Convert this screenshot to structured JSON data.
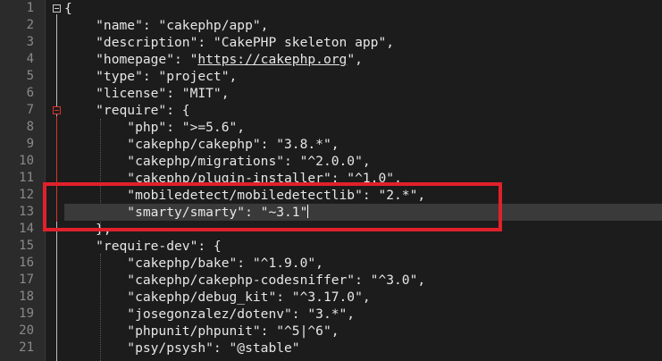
{
  "editor": {
    "lines": [
      {
        "num": "1",
        "text": "{"
      },
      {
        "num": "2",
        "text": "    \"name\": \"cakephp/app\","
      },
      {
        "num": "3",
        "text": "    \"description\": \"CakePHP skeleton app\","
      },
      {
        "num": "4",
        "pre": "    \"homepage\": \"",
        "link": "https://cakephp.org",
        "post": "\","
      },
      {
        "num": "5",
        "text": "    \"type\": \"project\","
      },
      {
        "num": "6",
        "text": "    \"license\": \"MIT\","
      },
      {
        "num": "7",
        "text": "    \"require\": {"
      },
      {
        "num": "8",
        "text": "        \"php\": \">=5.6\","
      },
      {
        "num": "9",
        "text": "        \"cakephp/cakephp\": \"3.8.*\","
      },
      {
        "num": "10",
        "text": "        \"cakephp/migrations\": \"^2.0.0\","
      },
      {
        "num": "11",
        "text": "        \"cakephp/plugin-installer\": \"^1.0\","
      },
      {
        "num": "12",
        "text": "        \"mobiledetect/mobiledetectlib\": \"2.*\","
      },
      {
        "num": "13",
        "text": "        \"smarty/smarty\": \"~3.1\""
      },
      {
        "num": "14",
        "text": "    },"
      },
      {
        "num": "15",
        "text": "    \"require-dev\": {"
      },
      {
        "num": "16",
        "text": "        \"cakephp/bake\": \"^1.9.0\","
      },
      {
        "num": "17",
        "text": "        \"cakephp/cakephp-codesniffer\": \"^3.0\","
      },
      {
        "num": "18",
        "text": "        \"cakephp/debug_kit\": \"^3.17.0\","
      },
      {
        "num": "19",
        "text": "        \"josegonzalez/dotenv\": \"3.*\","
      },
      {
        "num": "20",
        "text": "        \"phpunit/phpunit\": \"^5|^6\","
      },
      {
        "num": "21",
        "text": "        \"psy/psysh\": \"@stable\""
      }
    ],
    "current_line": "13",
    "colors": {
      "background": "#1c1c1c",
      "gutter": "#2b2b2b",
      "current_line": "#3a3a3a",
      "fold_marker": "#d9342b",
      "highlight_box": "#e0212b",
      "text": "#e6e6e6",
      "line_number": "#8a8a8a"
    }
  }
}
